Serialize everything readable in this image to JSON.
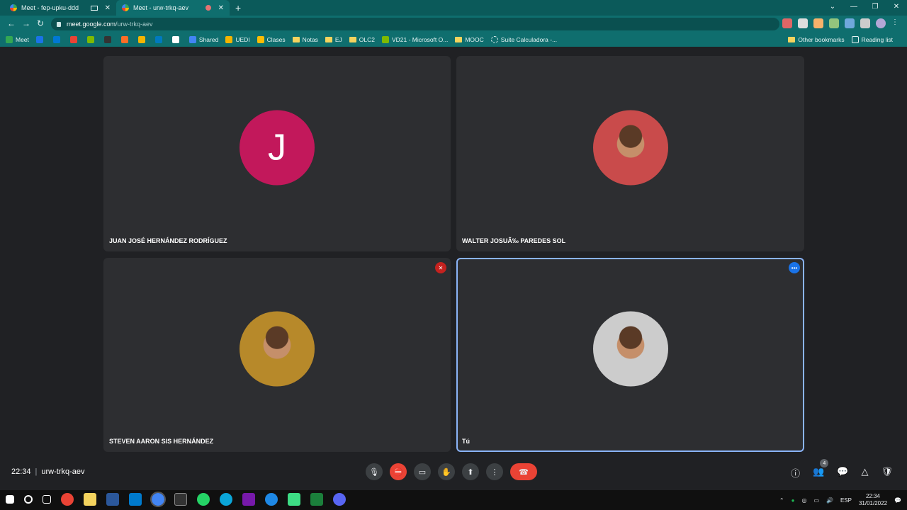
{
  "browser": {
    "tabs": [
      {
        "title": "Meet - fep-upku-ddd"
      },
      {
        "title": "Meet - urw-trkq-aev"
      }
    ],
    "url": {
      "host": "meet.google.com",
      "path": "/urw-trkq-aev"
    },
    "bookmarks": [
      "Meet",
      "Shared",
      "UEDI",
      "Clases",
      "Notas",
      "EJ",
      "OLC2",
      "VD21 - Microsoft O...",
      "MOOC",
      "Suite Calculadora -..."
    ],
    "bookmarks_right": [
      "Other bookmarks",
      "Reading list"
    ]
  },
  "meet": {
    "participants": [
      {
        "name": "JUAN JOSÉ HERNÁNDEZ RODRÍGUEZ",
        "avatar_letter": "J"
      },
      {
        "name": "WALTER JOSUÃ‰ PAREDES SOL"
      },
      {
        "name": "STEVEN AARON SIS HERNÁNDEZ"
      },
      {
        "name": "Tú"
      }
    ],
    "time": "22:34",
    "meeting_code": "urw-trkq-aev",
    "people_count": "4"
  },
  "taskbar": {
    "language": "ESP",
    "time": "22:34",
    "date": "31/01/2022"
  }
}
